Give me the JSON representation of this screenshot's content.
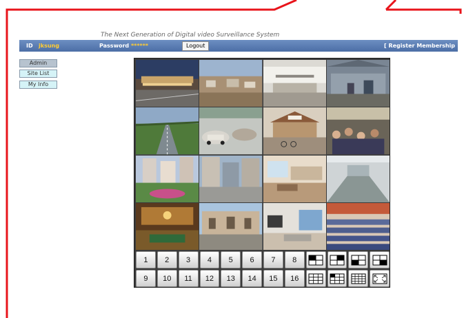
{
  "header": {
    "tagline": "The Next Generation of Digital video Surveillance System",
    "id_label": "ID",
    "id_value": "jksung",
    "password_label": "Password",
    "password_value": "******",
    "logout_label": "Logout",
    "register_label": "[ Register Membership"
  },
  "sidebar": {
    "items": [
      {
        "label": "Admin"
      },
      {
        "label": "Site List"
      },
      {
        "label": "My Info"
      }
    ]
  },
  "cameras": [
    {
      "scene": "airport-terminal-night"
    },
    {
      "scene": "construction-site"
    },
    {
      "scene": "office-lobby"
    },
    {
      "scene": "factory-warehouse"
    },
    {
      "scene": "highway"
    },
    {
      "scene": "parking-lot"
    },
    {
      "scene": "bicycle-parking"
    },
    {
      "scene": "crowded-market"
    },
    {
      "scene": "apartment-garden"
    },
    {
      "scene": "street-buildings"
    },
    {
      "scene": "interior-room"
    },
    {
      "scene": "empty-hall"
    },
    {
      "scene": "ballroom"
    },
    {
      "scene": "courtyard"
    },
    {
      "scene": "living-room"
    },
    {
      "scene": "auditorium-seats"
    }
  ],
  "controls": {
    "channels_row1": [
      "1",
      "2",
      "3",
      "4",
      "5",
      "6",
      "7",
      "8"
    ],
    "channels_row2": [
      "9",
      "10",
      "11",
      "12",
      "13",
      "14",
      "15",
      "16"
    ],
    "layouts_row1": [
      "quad-top-left-icon",
      "quad-top-right-icon",
      "quad-bottom-left-icon",
      "quad-bottom-right-icon"
    ],
    "layouts_row2": [
      "split-9-icon",
      "split-9-numbered-icon",
      "split-16-icon",
      "fullscreen-icon"
    ]
  },
  "colors": {
    "frame_red": "#e8141b",
    "topbar_blue": "#5577b0",
    "credential_yellow": "#ffcc33",
    "sidebar_cyan": "#d5f3f7"
  }
}
